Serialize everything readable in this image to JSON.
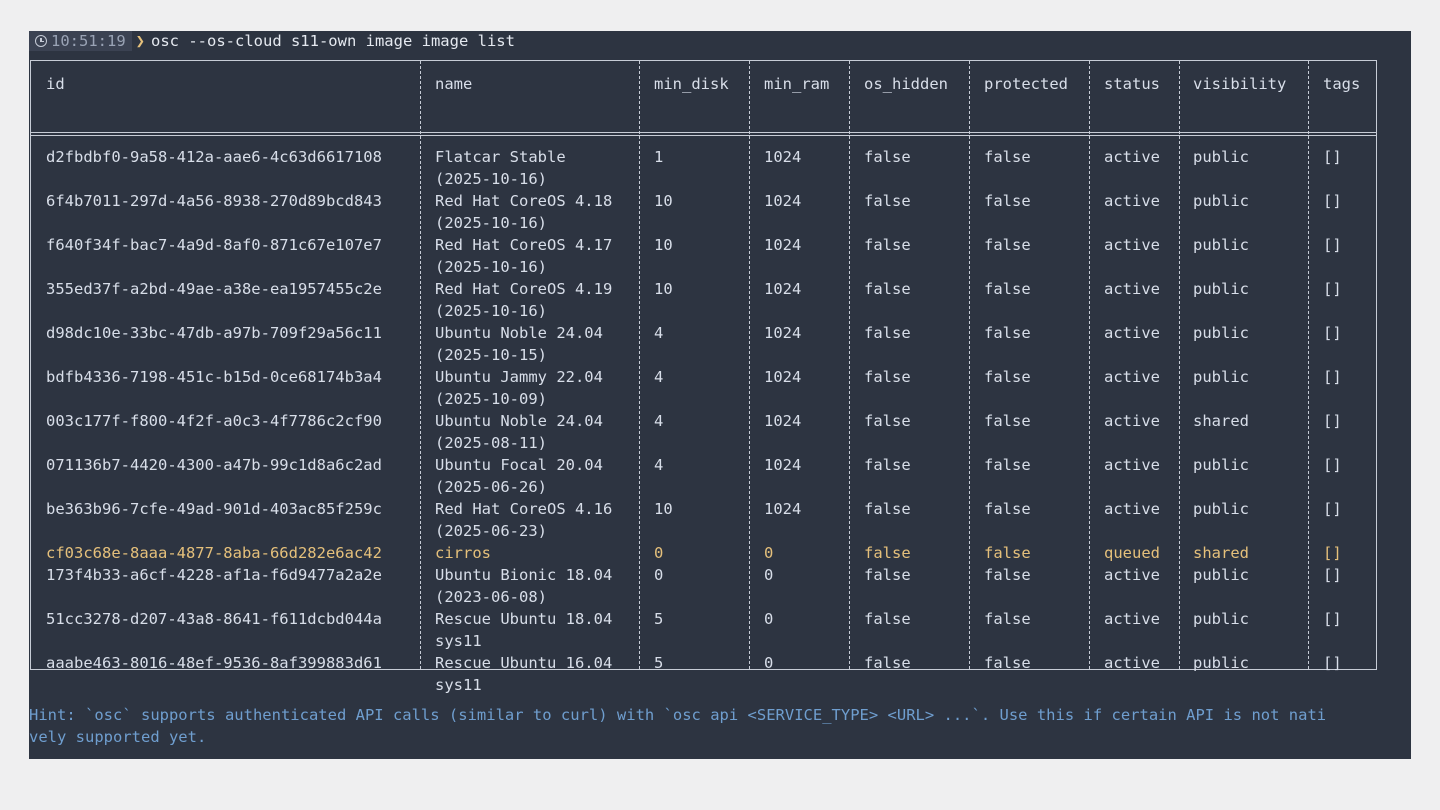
{
  "prompt": {
    "time": "10:51:19",
    "arrow": "❯",
    "command": "osc --os-cloud s11-own image image list"
  },
  "table": {
    "columns": [
      "id",
      "name",
      "min_disk",
      "min_ram",
      "os_hidden",
      "protected",
      "status",
      "visibility",
      "tags"
    ],
    "rows": [
      {
        "id": "d2fbdbf0-9a58-412a-aae6-4c63d6617108",
        "name": [
          "Flatcar Stable",
          "(2025-10-16)"
        ],
        "min_disk": "1",
        "min_ram": "1024",
        "os_hidden": "false",
        "protected": "false",
        "status": "active",
        "visibility": "public",
        "tags": "[]"
      },
      {
        "id": "6f4b7011-297d-4a56-8938-270d89bcd843",
        "name": [
          "Red Hat CoreOS 4.18",
          "(2025-10-16)"
        ],
        "min_disk": "10",
        "min_ram": "1024",
        "os_hidden": "false",
        "protected": "false",
        "status": "active",
        "visibility": "public",
        "tags": "[]"
      },
      {
        "id": "f640f34f-bac7-4a9d-8af0-871c67e107e7",
        "name": [
          "Red Hat CoreOS 4.17",
          "(2025-10-16)"
        ],
        "min_disk": "10",
        "min_ram": "1024",
        "os_hidden": "false",
        "protected": "false",
        "status": "active",
        "visibility": "public",
        "tags": "[]"
      },
      {
        "id": "355ed37f-a2bd-49ae-a38e-ea1957455c2e",
        "name": [
          "Red Hat CoreOS 4.19",
          "(2025-10-16)"
        ],
        "min_disk": "10",
        "min_ram": "1024",
        "os_hidden": "false",
        "protected": "false",
        "status": "active",
        "visibility": "public",
        "tags": "[]"
      },
      {
        "id": "d98dc10e-33bc-47db-a97b-709f29a56c11",
        "name": [
          "Ubuntu Noble 24.04",
          "(2025-10-15)"
        ],
        "min_disk": "4",
        "min_ram": "1024",
        "os_hidden": "false",
        "protected": "false",
        "status": "active",
        "visibility": "public",
        "tags": "[]"
      },
      {
        "id": "bdfb4336-7198-451c-b15d-0ce68174b3a4",
        "name": [
          "Ubuntu Jammy 22.04",
          "(2025-10-09)"
        ],
        "min_disk": "4",
        "min_ram": "1024",
        "os_hidden": "false",
        "protected": "false",
        "status": "active",
        "visibility": "public",
        "tags": "[]"
      },
      {
        "id": "003c177f-f800-4f2f-a0c3-4f7786c2cf90",
        "name": [
          "Ubuntu Noble 24.04",
          "(2025-08-11)"
        ],
        "min_disk": "4",
        "min_ram": "1024",
        "os_hidden": "false",
        "protected": "false",
        "status": "active",
        "visibility": "shared",
        "tags": "[]"
      },
      {
        "id": "071136b7-4420-4300-a47b-99c1d8a6c2ad",
        "name": [
          "Ubuntu Focal 20.04",
          "(2025-06-26)"
        ],
        "min_disk": "4",
        "min_ram": "1024",
        "os_hidden": "false",
        "protected": "false",
        "status": "active",
        "visibility": "public",
        "tags": "[]"
      },
      {
        "id": "be363b96-7cfe-49ad-901d-403ac85f259c",
        "name": [
          "Red Hat CoreOS 4.16",
          "(2025-06-23)"
        ],
        "min_disk": "10",
        "min_ram": "1024",
        "os_hidden": "false",
        "protected": "false",
        "status": "active",
        "visibility": "public",
        "tags": "[]"
      },
      {
        "id": "cf03c68e-8aaa-4877-8aba-66d282e6ac42",
        "name": [
          "cirros"
        ],
        "min_disk": "0",
        "min_ram": "0",
        "os_hidden": "false",
        "protected": "false",
        "status": "queued",
        "visibility": "shared",
        "tags": "[]",
        "highlight": true
      },
      {
        "id": "173f4b33-a6cf-4228-af1a-f6d9477a2a2e",
        "name": [
          "Ubuntu Bionic 18.04",
          "(2023-06-08)"
        ],
        "min_disk": "0",
        "min_ram": "0",
        "os_hidden": "false",
        "protected": "false",
        "status": "active",
        "visibility": "public",
        "tags": "[]"
      },
      {
        "id": "51cc3278-d207-43a8-8641-f611dcbd044a",
        "name": [
          "Rescue Ubuntu 18.04",
          "sys11"
        ],
        "min_disk": "5",
        "min_ram": "0",
        "os_hidden": "false",
        "protected": "false",
        "status": "active",
        "visibility": "public",
        "tags": "[]"
      },
      {
        "id": "aaabe463-8016-48ef-9536-8af399883d61",
        "name": [
          "Rescue Ubuntu 16.04",
          "sys11"
        ],
        "min_disk": "5",
        "min_ram": "0",
        "os_hidden": "false",
        "protected": "false",
        "status": "active",
        "visibility": "public",
        "tags": "[]"
      }
    ]
  },
  "hint": {
    "line1": "Hint: `osc` supports authenticated API calls (similar to curl) with `osc api <SERVICE_TYPE> <URL> ...`. Use this if certain API is not nati",
    "line2": "vely supported yet."
  },
  "colors": {
    "terminal_bg": "#2d3441",
    "text": "#d8dee9",
    "highlight_row": "#e5c07b",
    "hint": "#6f9ecf",
    "border": "#c7ccd6"
  }
}
